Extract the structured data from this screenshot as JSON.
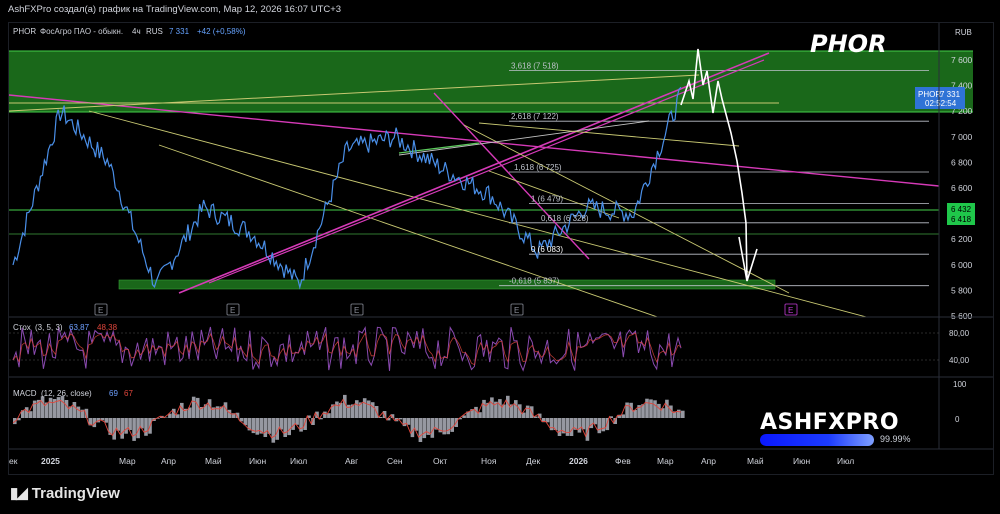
{
  "header": {
    "caption": "AshFXPro создал(а) график на TradingView.com, Мар 12, 2026 16:07 UTC+3"
  },
  "symbol_line": {
    "ticker": "PHOR",
    "name": "ФосАгро ПАО - обыкн.",
    "interval": "4ч",
    "exchange": "RUS",
    "last": "7 331",
    "change": "+42 (+0,58%)"
  },
  "overlay": {
    "title": "PHOR"
  },
  "price_axis": {
    "currency": "RUB",
    "ticks": [
      "7 600",
      "7 400",
      "7 200",
      "7 000",
      "6 800",
      "6 600",
      "6 400",
      "6 200",
      "6 000",
      "5 800",
      "5 600"
    ],
    "last_label_ticker": "PHOR",
    "last_label_value": "7 331",
    "last_label_timer": "02:52:54",
    "green_label_1": "6 432",
    "green_label_2": "6 418"
  },
  "fib_labels": [
    "3,618 (7 518)",
    "2,618 (7 122)",
    "1,618 (6 725)",
    "1 (6 479)",
    "0,618 (6 328)",
    "0 (6 083)",
    "-0,618 (5 837)"
  ],
  "time_axis": [
    "ек",
    "2025",
    "Мар",
    "Апр",
    "Май",
    "Июн",
    "Июл",
    "Авг",
    "Сен",
    "Окт",
    "Ноя",
    "Дек",
    "2026",
    "Фев",
    "Мар",
    "Апр",
    "Май",
    "Июн",
    "Июл"
  ],
  "earnings_marker": "E",
  "stoch": {
    "label": "Стох",
    "params": "(3, 5, 3)",
    "k": "63,87",
    "d": "48,38",
    "ticks": [
      "80,00",
      "40,00"
    ]
  },
  "macd": {
    "label": "MACD",
    "params": "(12, 26, close)",
    "v1": "69",
    "v2": "67",
    "ticks": [
      "100",
      "0"
    ]
  },
  "branding": {
    "name": "ASHFXPRO",
    "percent": "99.99%"
  },
  "footer": {
    "logo_text": "TradingView"
  },
  "colors": {
    "price_line": "#4a8fe8",
    "zone_green": "#1f7a1f",
    "fan_pink": "#d63ab8",
    "stoch_purple": "#8a4ab0",
    "stoch_red": "#e0463c",
    "macd_hist": "#b0b3bd",
    "macd_signal": "#e0463c"
  },
  "chart_data": {
    "type": "line",
    "title": "PHOR",
    "ylabel": "RUB",
    "ylim": [
      5600,
      7700
    ],
    "x": [
      "2025-01",
      "2025-02",
      "2025-03",
      "2025-04",
      "2025-05",
      "2025-06",
      "2025-07",
      "2025-08",
      "2025-09",
      "2025-10",
      "2025-11",
      "2025-12",
      "2026-01",
      "2026-02",
      "2026-03"
    ],
    "series": [
      {
        "name": "PHOR",
        "values": [
          6000,
          7200,
          6800,
          5830,
          6450,
          6250,
          5850,
          6900,
          7000,
          6750,
          6550,
          6100,
          6450,
          6400,
          7331
        ]
      }
    ],
    "fib_levels": [
      7518,
      7122,
      6725,
      6479,
      6328,
      6083,
      5837
    ],
    "grid": false,
    "legend": "none"
  }
}
